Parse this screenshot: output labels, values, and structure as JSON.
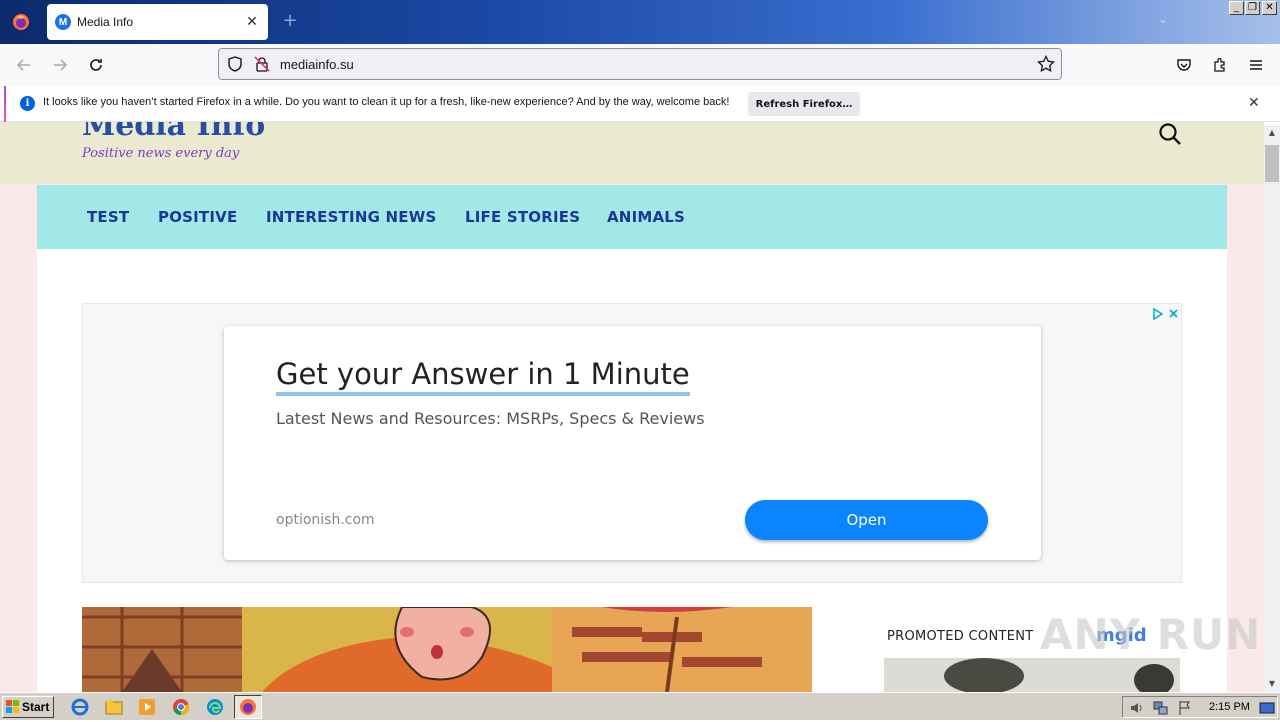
{
  "browser": {
    "tab_title": "Media Info",
    "tab_favicon_letter": "M",
    "url": "mediainfo.su",
    "new_tab_symbol": "+",
    "window_controls": [
      "_",
      "❐",
      "✕"
    ]
  },
  "notification": {
    "message": "It looks like you haven’t started Firefox in a while. Do you want to clean it up for a fresh, like-new experience? And by the way, welcome back!",
    "button_label": "Refresh Firefox…"
  },
  "site": {
    "logo": "Media Info",
    "tagline": "Positive news every day",
    "menu": [
      "TEST",
      "POSITIVE",
      "INTERESTING NEWS",
      "LIFE STORIES",
      "ANIMALS"
    ]
  },
  "ad": {
    "headline": "Get your Answer in 1 Minute",
    "subtext": "Latest News and Resources: MSRPs, Specs & Reviews",
    "domain": "optionish.com",
    "cta": "Open"
  },
  "sidebar": {
    "promoted_label": "PROMOTED CONTENT",
    "promo_brand": "mgid"
  },
  "watermark": "ANY RUN",
  "taskbar": {
    "start_label": "Start",
    "clock": "2:15 PM"
  },
  "colors": {
    "header_bg": "#ebead0",
    "menu_bg": "#a1e8e6",
    "menu_text": "#1a3696",
    "cta_blue": "#0a84ff",
    "page_bg": "#fbe9ea"
  }
}
